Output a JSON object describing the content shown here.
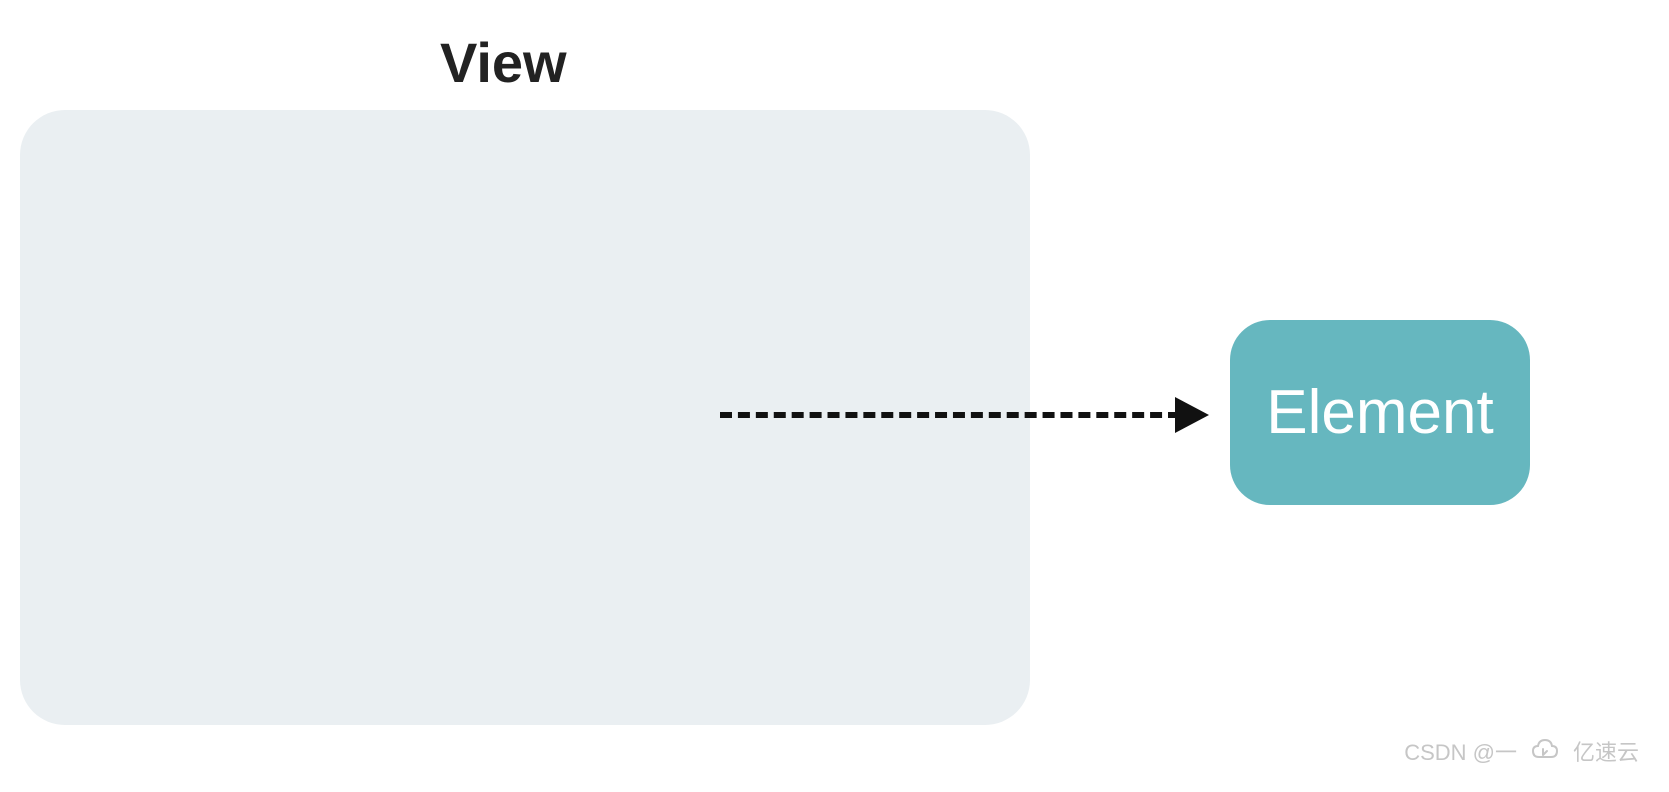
{
  "diagram": {
    "title": "View",
    "element_label": "Element"
  },
  "watermark": {
    "text_left": "CSDN @一",
    "text_right": "亿速云"
  }
}
